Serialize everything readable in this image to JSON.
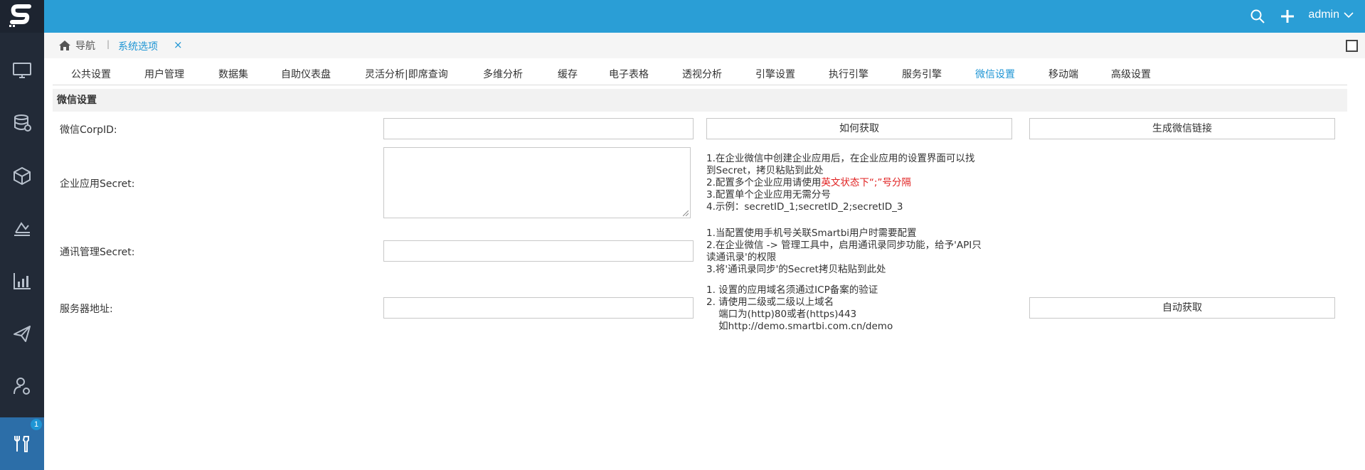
{
  "topbar": {
    "user": "admin"
  },
  "sidebar": {
    "badge": "1",
    "items": [
      {
        "icon": "monitor-icon"
      },
      {
        "icon": "database-icon"
      },
      {
        "icon": "cube-icon"
      },
      {
        "icon": "analysis-icon"
      },
      {
        "icon": "bar-chart-icon"
      },
      {
        "icon": "send-icon"
      },
      {
        "icon": "user-settings-icon"
      },
      {
        "icon": "tools-icon"
      }
    ]
  },
  "breadcrumb": {
    "home": "导航",
    "separator": "|",
    "tab": "系统选项",
    "close": "×"
  },
  "tabs": [
    "公共设置",
    "用户管理",
    "数据集",
    "自助仪表盘",
    "灵活分析|即席查询",
    "多维分析",
    "缓存",
    "电子表格",
    "透视分析",
    "引擎设置",
    "执行引擎",
    "服务引擎",
    "微信设置",
    "移动端",
    "高级设置"
  ],
  "active_tab": "微信设置",
  "section": {
    "title": "微信设置"
  },
  "form": {
    "corpid": {
      "label": "微信CorpID:",
      "value": "",
      "how_button": "如何获取",
      "generate_button": "生成微信链接"
    },
    "app_secret": {
      "label": "企业应用Secret:",
      "value": "",
      "help": {
        "line1": "1.在企业微信中创建企业应用后，在企业应用的设置界面可以找",
        "line2": "到Secret，拷贝粘贴到此处",
        "line3_prefix": "2.配置多个企业应用请使用",
        "line3_red": "英文状态下“;”号分隔",
        "line4": "3.配置单个企业应用无需分号",
        "line5": "4.示例：secretID_1;secretID_2;secretID_3"
      }
    },
    "contact_secret": {
      "label": "通讯管理Secret:",
      "value": "",
      "help": {
        "line1": "1.当配置使用手机号关联Smartbi用户时需要配置",
        "line2": "2.在企业微信 -> 管理工具中，启用通讯录同步功能，给予'API只",
        "line3": "读通讯录'的权限",
        "line4": "3.将'通讯录同步'的Secret拷贝粘贴到此处"
      }
    },
    "server": {
      "label": "服务器地址:",
      "value": "",
      "auto_button": "自动获取",
      "help": {
        "line1": "1. 设置的应用域名须通过ICP备案的验证",
        "line2": "2. 请使用二级或二级以上域名",
        "line3": "    端口为(http)80或者(https)443",
        "line4": "    如http://demo.smartbi.com.cn/demo"
      }
    }
  }
}
